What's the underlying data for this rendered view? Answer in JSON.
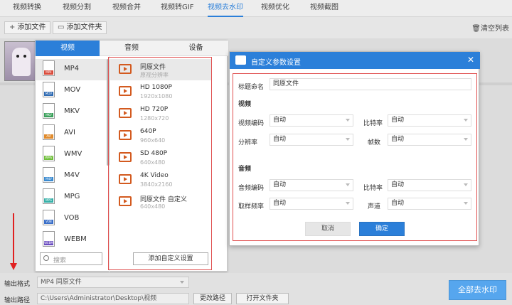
{
  "nav": {
    "tabs": [
      "视频转换",
      "视频分割",
      "视频合并",
      "视频转GIF",
      "视频去水印",
      "视频优化",
      "视频截图"
    ],
    "active_index": 4
  },
  "toolbar": {
    "add_file": "添加文件",
    "add_folder": "添加文件夹",
    "clear_list": "清空列表"
  },
  "format_panel": {
    "tabs": [
      "视频",
      "音频",
      "设备"
    ],
    "active_tab": 0,
    "formats": [
      {
        "name": "MP4",
        "color": "#d94a3a"
      },
      {
        "name": "MOV",
        "color": "#2f6bb3"
      },
      {
        "name": "MKV",
        "color": "#3aa05a"
      },
      {
        "name": "AVI",
        "color": "#e08a2b"
      },
      {
        "name": "WMV",
        "color": "#6fbf3a"
      },
      {
        "name": "M4V",
        "color": "#3a8ad0"
      },
      {
        "name": "MPG",
        "color": "#36b0a8"
      },
      {
        "name": "VOB",
        "color": "#3a6fc9"
      },
      {
        "name": "WEBM",
        "color": "#6a4cc0"
      }
    ],
    "selected_format": "MP4",
    "presets": [
      {
        "title": "同原文件",
        "sub": "原视分辨率"
      },
      {
        "title": "HD 1080P",
        "sub": "1920x1080"
      },
      {
        "title": "HD 720P",
        "sub": "1280x720"
      },
      {
        "title": "640P",
        "sub": "960x640"
      },
      {
        "title": "SD 480P",
        "sub": "640x480"
      },
      {
        "title": "4K Video",
        "sub": "3840x2160"
      },
      {
        "title": "同原文件 自定义",
        "sub": "640x480"
      }
    ],
    "search_placeholder": "搜索",
    "add_custom": "添加自定义设置"
  },
  "dialog": {
    "title": "自定义参数设置",
    "name_label": "标题命名",
    "name_value": "同原文件",
    "video_section": "视频",
    "video_encoder_label": "视频编码",
    "video_encoder_value": "自动",
    "video_bitrate_label": "比特率",
    "video_bitrate_value": "自动",
    "resolution_label": "分辨率",
    "resolution_value": "自动",
    "fps_label": "帧数",
    "fps_value": "自动",
    "audio_section": "音频",
    "audio_encoder_label": "音频编码",
    "audio_encoder_value": "自动",
    "audio_bitrate_label": "比特率",
    "audio_bitrate_value": "自动",
    "sample_rate_label": "取样频率",
    "sample_rate_value": "自动",
    "channel_label": "声道",
    "channel_value": "自动",
    "cancel": "取消",
    "ok": "确定"
  },
  "bottom": {
    "output_format_label": "输出格式",
    "output_format_value": "MP4 同原文件",
    "output_path_label": "输出路径",
    "output_path_value": "C:\\Users\\Administrator\\Desktop\\视频",
    "change_path": "更改路径",
    "open_folder": "打开文件夹",
    "remove_all": "全部去水印"
  }
}
